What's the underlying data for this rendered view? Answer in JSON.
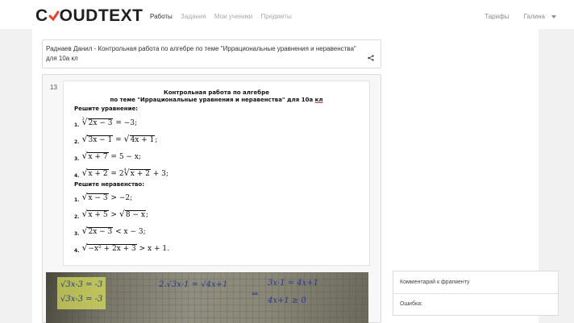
{
  "header": {
    "logo_left": "C",
    "logo_right": "OUDTEXT",
    "nav": [
      "Работы",
      "Задания",
      "Мои ученики",
      "Предметы"
    ],
    "right": {
      "tariffs": "Тарифы",
      "user": "Галина"
    }
  },
  "work": {
    "title": "Раднаев Данил - Контрольная работа по алгебре по теме \"Иррациональные уравнения и неравенства\" для 10а кл",
    "number": "13"
  },
  "sheet": {
    "title_line1": "Контрольная работа по алгебре",
    "title_line2_main": "по теме \"Иррациональные уравнения и неравенства\" для 10а ",
    "title_line2_tail": "кл",
    "section1": "Решите уравнение:",
    "section2": "Решите неравенство:",
    "items_numbers": [
      "1.",
      "2.",
      "3.",
      "4.",
      "1.",
      "2.",
      "3.",
      "4."
    ],
    "eq1_idx": "3",
    "eq1_rad": "2x − 3",
    "eq1_rest": " = −3;",
    "eq2_rad_a": "3x − 1",
    "eq2_mid": " = ",
    "eq2_rad_b": "4x + 1",
    "eq2_rest": ";",
    "eq3_rad": "x + 7",
    "eq3_rest": " = 5 − x;",
    "eq4_rad": "x + 2",
    "eq4_mid": " = 2",
    "eq4_idx": "4",
    "eq4_rad_b": "x + 2",
    "eq4_rest": " + 3;",
    "in1_rad": "x − 3",
    "in1_rest": " > −2;",
    "in2_rad_a": "x + 5",
    "in2_mid": " > ",
    "in2_rad_b": "8 − x",
    "in2_rest": ";",
    "in3_rad": "2x − 3",
    "in3_rest": " < x − 3;",
    "in4_rad": "−x² + 2x + 3",
    "in4_rest": " > x + 1."
  },
  "photo": {
    "hw1": "√3x-3 = -3",
    "hw2": "2.√3x-1 = √4x+1",
    "hw3": "3x-1 = 4x+1",
    "hw4": "4x+1 ≥ 0",
    "hw5": "⇔",
    "hw6": "√3x-3 = -3"
  },
  "comments": {
    "fragment_label": "Комментарий к фрагменту",
    "error_label": "Ошибка:"
  },
  "colors": {
    "accent": "#e4422d",
    "bg": "#f1f1f1"
  }
}
